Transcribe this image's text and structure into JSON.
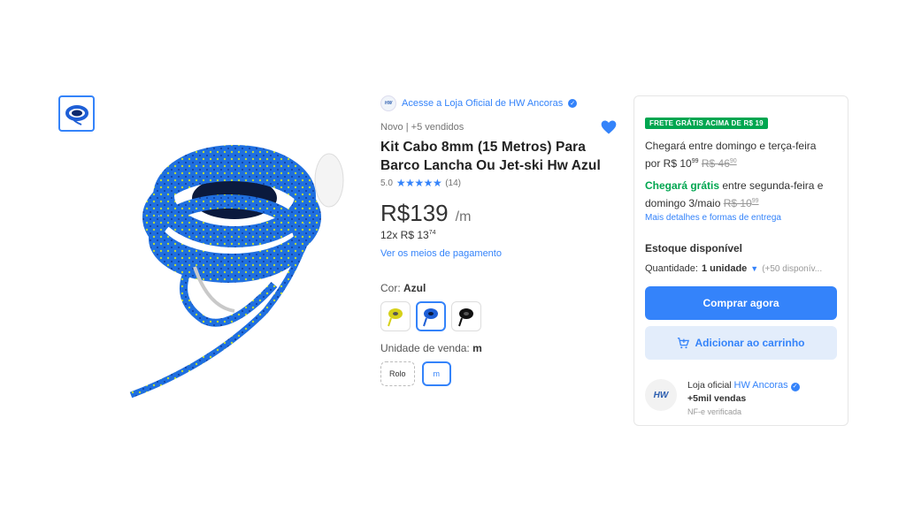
{
  "thumbnail": {
    "icon": "rope-thumbnail"
  },
  "product_image": {
    "icon": "blue-rope-coil-image"
  },
  "store": {
    "logo_text": "HW",
    "link_text": "Acesse a Loja Oficial de HW Ancoras"
  },
  "product": {
    "subtitle": "Novo  |  +5 vendidos",
    "title": "Kit Cabo 8mm (15 Metros) Para Barco Lancha Ou Jet-ski Hw Azul",
    "rating": "5.0",
    "stars": "★★★★★",
    "reviews": "(14)",
    "price_currency": "R$",
    "price_value": "139",
    "price_unit": "/m",
    "installments_prefix": "12x R$ 13",
    "installments_cents": "74",
    "payment_link": "Ver os meios de pagamento",
    "color_label": "Cor:",
    "color_value": "Azul",
    "unit_label": "Unidade de venda:",
    "unit_value": "m",
    "unit_options": [
      "Rolo",
      "m"
    ]
  },
  "colors": {
    "accent": "#3483fa",
    "green": "#00a650",
    "yellow": "#d6d11a",
    "blue": "#1f5fd6",
    "black": "#111111"
  },
  "shipping": {
    "badge": "FRETE GRÁTIS ACIMA DE R$ 19",
    "line1_a": "Chegará entre domingo e terça-feira",
    "line1_b": "por R$ 10",
    "line1_b_cents": "99",
    "line1_strike": "R$ 46",
    "line1_strike_cents": "90",
    "free_label": "Chegará grátis",
    "line2_a": " entre segunda-feira e",
    "line2_b": "domingo 3/maio ",
    "line2_strike": "R$ 10",
    "line2_strike_cents": "99",
    "details_link": "Mais detalhes e formas de entrega"
  },
  "stock": {
    "title": "Estoque disponível",
    "qty_label": "Quantidade:",
    "qty_value": "1 unidade",
    "available": "(+50 disponív..."
  },
  "buttons": {
    "buy": "Comprar agora",
    "cart": "Adicionar ao carrinho"
  },
  "seller": {
    "logo_text": "HW",
    "label": "Loja oficial ",
    "name": "HW Ancoras",
    "sales": "+5mil vendas",
    "invoice": "NF-e verificada"
  }
}
